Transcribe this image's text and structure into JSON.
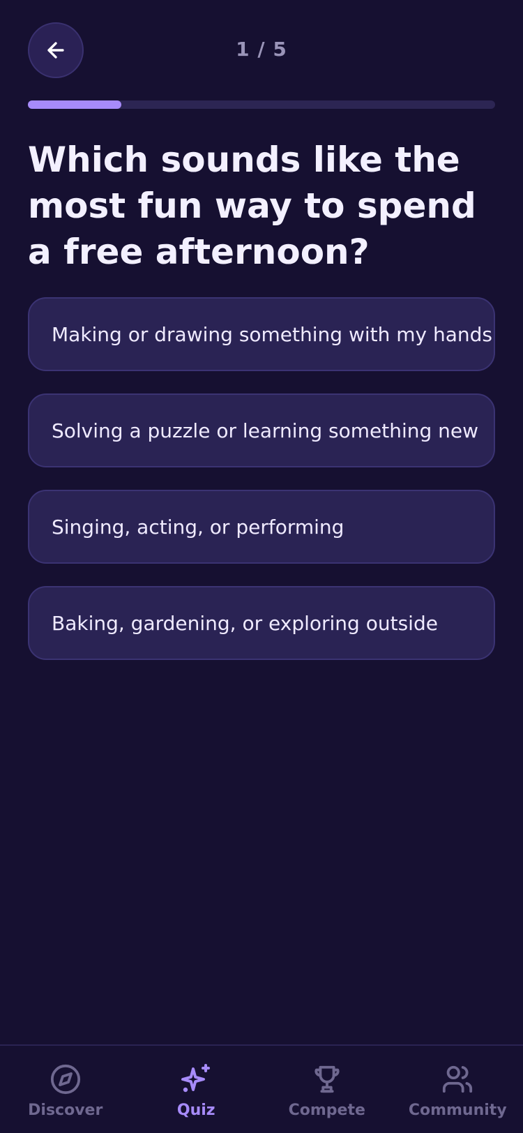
{
  "header": {
    "counter": "1 / 5"
  },
  "progress": {
    "current": 1,
    "total": 5,
    "fraction": 0.2
  },
  "question": {
    "text": "Which sounds like the most fun way to spend a free afternoon?"
  },
  "options": [
    {
      "label": "Making or drawing something with my hands"
    },
    {
      "label": "Solving a puzzle or learning something new"
    },
    {
      "label": "Singing, acting, or performing"
    },
    {
      "label": "Baking, gardening, or exploring outside"
    }
  ],
  "nav": {
    "items": [
      {
        "label": "Discover",
        "icon": "compass-icon",
        "active": false
      },
      {
        "label": "Quiz",
        "icon": "sparkles-icon",
        "active": true
      },
      {
        "label": "Compete",
        "icon": "trophy-icon",
        "active": false
      },
      {
        "label": "Community",
        "icon": "users-icon",
        "active": false
      }
    ]
  },
  "colors": {
    "background": "#161031",
    "accent": "#a78bfa",
    "card": "#2a2354",
    "muted": "#6f6890"
  }
}
